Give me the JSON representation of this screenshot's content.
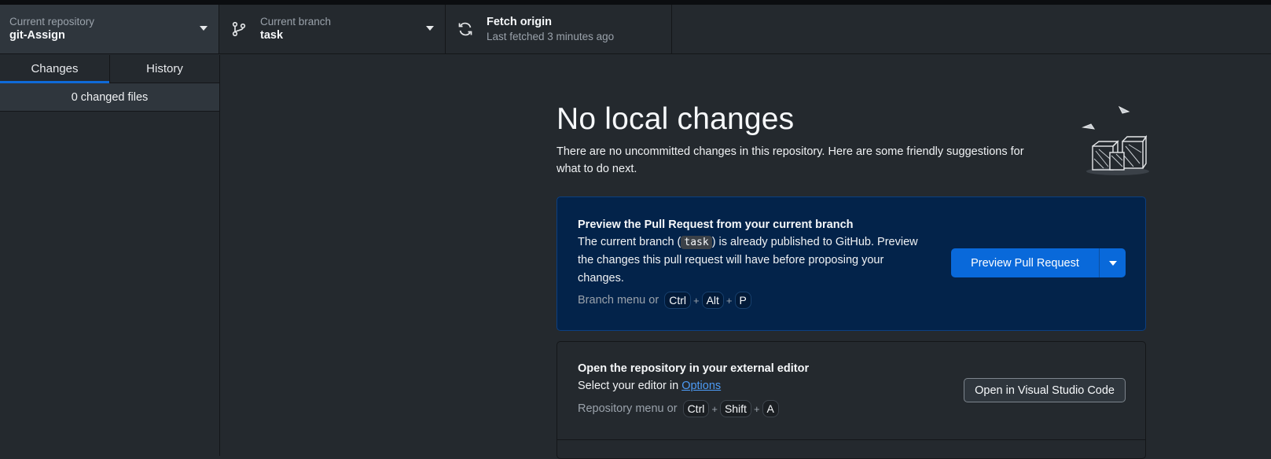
{
  "toolbar": {
    "repo": {
      "label": "Current repository",
      "value": "git-Assign"
    },
    "branch": {
      "label": "Current branch",
      "value": "task"
    },
    "fetch": {
      "label": "Fetch origin",
      "value": "Last fetched 3 minutes ago"
    }
  },
  "sidebar": {
    "tabs": [
      {
        "label": "Changes",
        "active": true
      },
      {
        "label": "History",
        "active": false
      }
    ],
    "changed_files": "0 changed files"
  },
  "main": {
    "title": "No local changes",
    "subtitle": "There are no uncommitted changes in this repository. Here are some friendly suggestions for what to do next.",
    "pr_card": {
      "title": "Preview the Pull Request from your current branch",
      "desc_pre": "The current branch (",
      "branch_code": "task",
      "desc_post": ") is already published to GitHub. Preview the changes this pull request will have before proposing your changes.",
      "hint_text": "Branch menu or",
      "keys": [
        "Ctrl",
        "Alt",
        "P"
      ],
      "button_label": "Preview Pull Request"
    },
    "editor_card": {
      "title": "Open the repository in your external editor",
      "desc_pre": "Select your editor in ",
      "desc_link": "Options",
      "hint_text": "Repository menu or",
      "keys": [
        "Ctrl",
        "Shift",
        "A"
      ],
      "button_label": "Open in Visual Studio Code"
    }
  },
  "colors": {
    "background": "#24292e",
    "accent": "#0969da",
    "pr_card_bg": "#03234a",
    "link": "#4d9bf5"
  },
  "icons": [
    "caret-down-icon",
    "branch-icon",
    "sync-icon",
    "boxes-illustration"
  ]
}
